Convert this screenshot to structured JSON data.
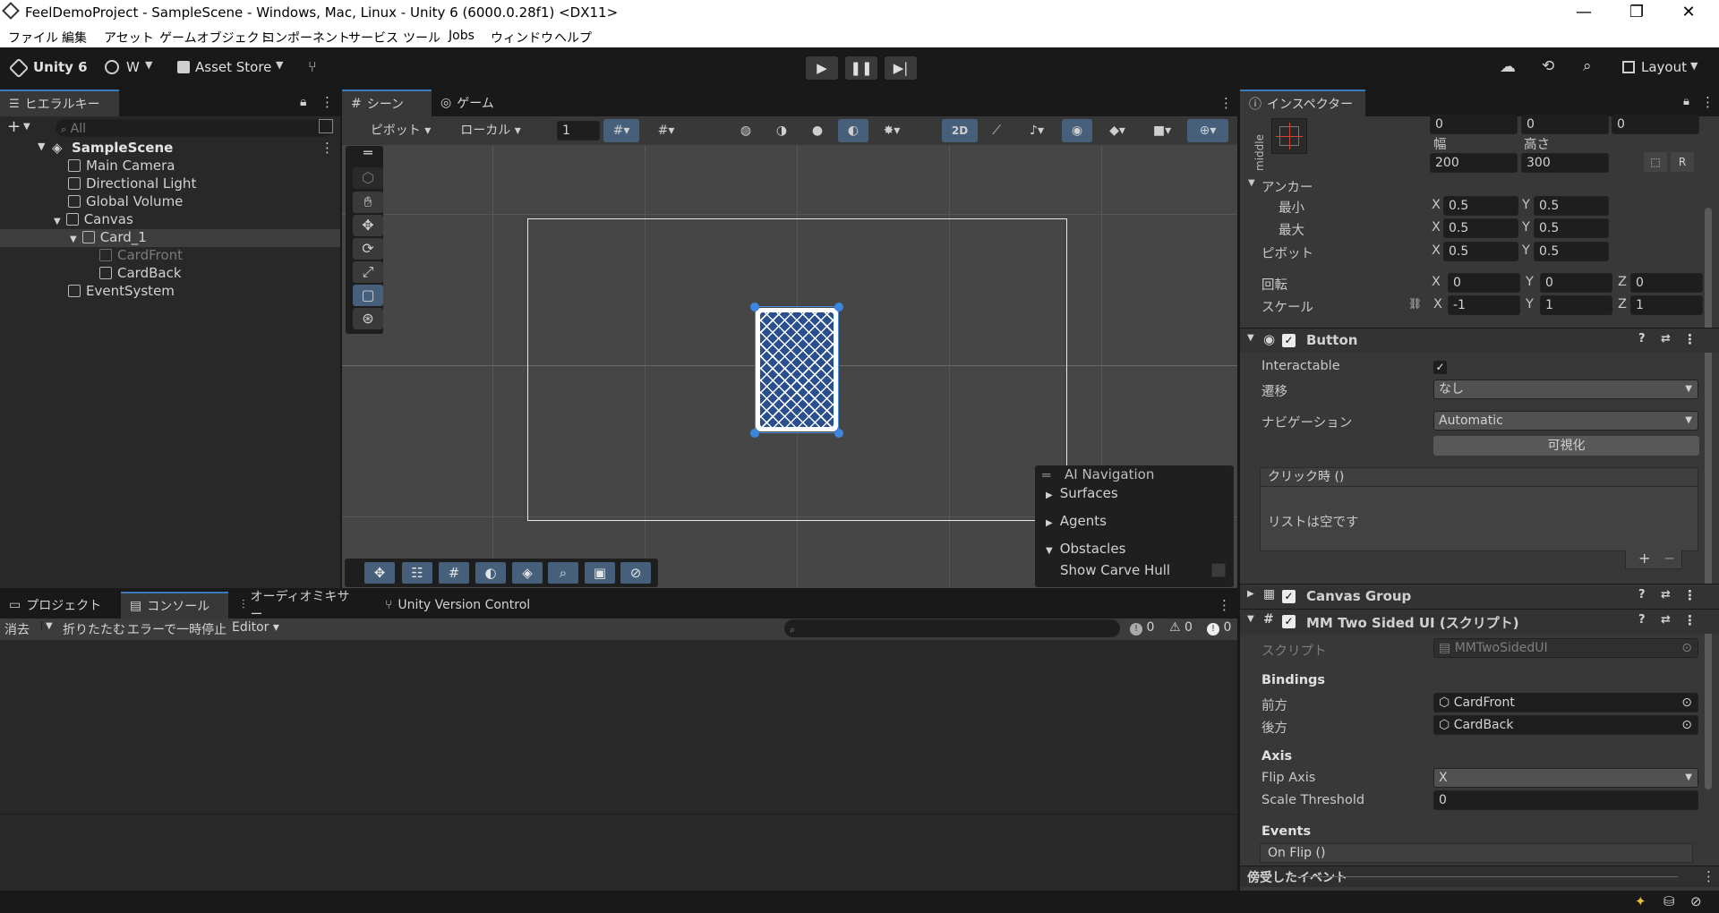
{
  "window": {
    "title": "FeelDemoProject - SampleScene - Windows, Mac, Linux - Unity 6 (6000.0.28f1) <DX11>",
    "minimize": "—",
    "restore": "❐",
    "close": "✕"
  },
  "menu": [
    "ファイル",
    "編集",
    "アセット",
    "ゲームオブジェクト",
    "コンポーネント",
    "サービス",
    "ツール",
    "Jobs",
    "ウィンドウ",
    "ヘルプ"
  ],
  "toolbar": {
    "unity_label": "Unity 6",
    "account_label": "W",
    "asset_store_label": "Asset Store",
    "layout_label": "Layout"
  },
  "hierarchy": {
    "tab_label": "ヒエラルキー",
    "search_placeholder": "All",
    "scene_name": "SampleScene",
    "items": [
      {
        "label": "Main Camera"
      },
      {
        "label": "Directional Light"
      },
      {
        "label": "Global Volume"
      },
      {
        "label": "Canvas"
      },
      {
        "label": "Card_1"
      },
      {
        "label": "CardFront"
      },
      {
        "label": "CardBack"
      },
      {
        "label": "EventSystem"
      }
    ]
  },
  "scene_view": {
    "tab_scene": "シーン",
    "tab_game": "ゲーム",
    "pivot_label": "ピボット",
    "local_label": "ローカル",
    "grid_value": "1",
    "mode_2d": "2D",
    "ai_nav": {
      "title": "AI Navigation",
      "items": [
        "Surfaces",
        "Agents",
        "Obstacles"
      ],
      "show_carve_hull": "Show Carve Hull"
    }
  },
  "bottom_panel": {
    "tabs": [
      "プロジェクト",
      "コンソール",
      "オーディオミキサー",
      "Unity Version Control"
    ],
    "clear_label": "消去",
    "collapse_label": "折りたたむ",
    "error_pause_label": "エラーで一時停止",
    "editor_label": "Editor",
    "count_info": "0",
    "count_warn": "0",
    "count_error": "0"
  },
  "inspector": {
    "tab_label": "インスペクター",
    "rect": {
      "pos_x": "0",
      "pos_y": "0",
      "pos_z": "0",
      "anchor_preset_label": "middle",
      "width_label": "幅",
      "height_label": "高さ",
      "width": "200",
      "height": "300",
      "r_label": "R",
      "anchors_label": "アンカー",
      "min_label": "最小",
      "max_label": "最大",
      "min_x": "0.5",
      "min_y": "0.5",
      "max_x": "0.5",
      "max_y": "0.5",
      "pivot_label": "ピボット",
      "pivot_x": "0.5",
      "pivot_y": "0.5",
      "rotation_label": "回転",
      "rot_x": "0",
      "rot_y": "0",
      "rot_z": "0",
      "scale_label": "スケール",
      "scale_x": "-1",
      "scale_y": "1",
      "scale_z": "1",
      "x": "X",
      "y": "Y",
      "z": "Z"
    },
    "button": {
      "title": "Button",
      "interactable_label": "Interactable",
      "transition_label": "遷移",
      "transition_value": "なし",
      "navigation_label": "ナビゲーション",
      "navigation_value": "Automatic",
      "visualize_label": "可視化",
      "onclick_label": "クリック時 ()",
      "empty_list": "リストは空です",
      "plus": "+",
      "minus": "−"
    },
    "canvas_group": {
      "title": "Canvas Group"
    },
    "mm_two_sided": {
      "title": "MM Two Sided UI (スクリプト)",
      "script_label": "スクリプト",
      "script_value": "MMTwoSidedUI",
      "bindings_label": "Bindings",
      "front_label": "前方",
      "front_value": "CardFront",
      "back_label": "後方",
      "back_value": "CardBack",
      "axis_label": "Axis",
      "flip_axis_label": "Flip Axis",
      "flip_axis_value": "X",
      "scale_threshold_label": "Scale Threshold",
      "scale_threshold_value": "0",
      "events_label": "Events",
      "on_flip_label": "On Flip ()"
    },
    "received_events_label": "傍受したイベント"
  },
  "colors": {
    "accent": "#3a79bb",
    "selection": "#46607c",
    "card_blue": "#2a4f8f"
  }
}
